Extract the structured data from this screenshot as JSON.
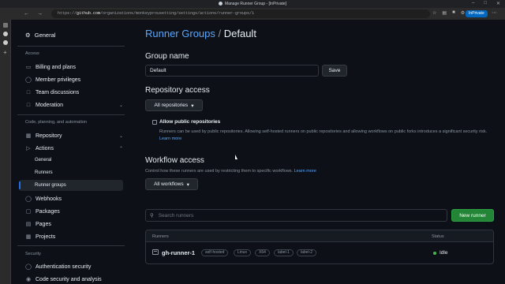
{
  "browser": {
    "tab_title": "Manage Runner Group - [InPrivate]",
    "url_prefix": "https://",
    "url_host": "github.com",
    "url_path": "/organizations/monkeyprousetting/settings/actions/runner-groups/1",
    "inprivate_label": "InPrivate",
    "icons": [
      "back-icon",
      "forward-icon",
      "refresh-icon",
      "favorites-icon",
      "collections-icon",
      "extensions-icon",
      "more-icon"
    ]
  },
  "sidebar": {
    "general": "General",
    "access_heading": "Access",
    "access_items": [
      "Billing and plans",
      "Member privileges",
      "Team discussions",
      "Moderation"
    ],
    "code_heading": "Code, planning, and automation",
    "repository": "Repository",
    "actions": "Actions",
    "actions_sub": [
      "General",
      "Runners",
      "Runner groups"
    ],
    "code_items": [
      "Webhooks",
      "Packages",
      "Pages",
      "Projects"
    ],
    "security_heading": "Security",
    "security_items": [
      "Authentication security",
      "Code security and analysis"
    ]
  },
  "main": {
    "breadcrumb_link": "Runner Groups",
    "breadcrumb_sep": " / ",
    "breadcrumb_current": "Default",
    "group_name_heading": "Group name",
    "group_name_value": "Default",
    "save_label": "Save",
    "repo_access_heading": "Repository access",
    "repo_access_select": "All repositories",
    "allow_public_label": "Allow public repositories",
    "allow_public_desc": "Runners can be used by public repositories. Allowing self-hosted runners on public repositories and allowing workflows on public forks introduces a significant security risk.",
    "learn_more": "Learn more",
    "workflow_heading": "Workflow access",
    "workflow_desc": "Control how these runners are used by restricting them to specific workflows.",
    "workflow_select": "All workflows",
    "search_placeholder": "Search runners",
    "new_runner": "New runner",
    "col_runners": "Runners",
    "col_status": "Status",
    "runner": {
      "name": "gh-runner-1",
      "labels": [
        "self-hosted",
        "Linux",
        "X64",
        "label-1",
        "label-2"
      ],
      "status": "Idle"
    }
  }
}
